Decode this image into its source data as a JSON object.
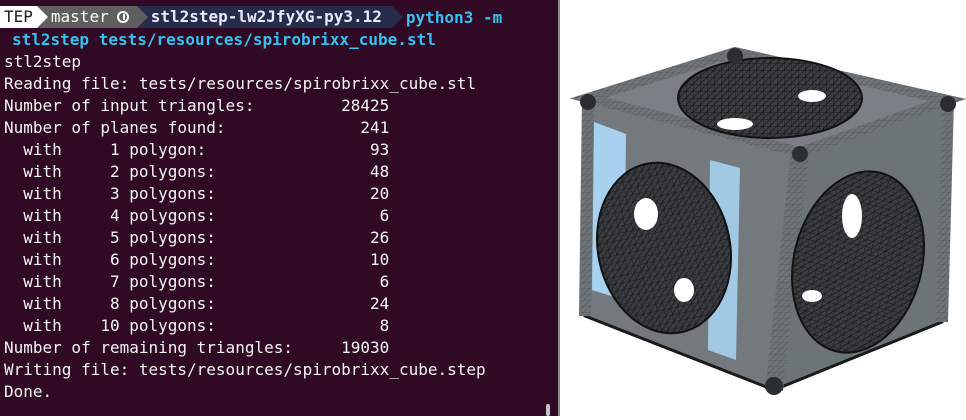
{
  "colors": {
    "terminal_bg": "#300a24",
    "command_color": "#35c2f0",
    "output_color": "#f5f5f5",
    "model_face_blue": "#a7d1ef",
    "model_face_gray": "#6d7478"
  },
  "prompt": {
    "segment_1": "TEP",
    "branch": "master",
    "branch_icon": "git-status-icon",
    "venv": "stl2step-lw2JfyXG-py3.12",
    "command_start": "python3 -m",
    "command_rest": "stl2step tests/resources/spirobrixx_cube.stl"
  },
  "output": {
    "program": "stl2step",
    "reading": "Reading file: tests/resources/spirobrixx_cube.stl",
    "input_triangles_label": "Number of input triangles:",
    "input_triangles_value": "28425",
    "planes_label": "Number of planes found:",
    "planes_value": "241",
    "polygon_rows": [
      {
        "with": "with",
        "n": "1",
        "label": "polygon:",
        "count": "93"
      },
      {
        "with": "with",
        "n": "2",
        "label": "polygons:",
        "count": "48"
      },
      {
        "with": "with",
        "n": "3",
        "label": "polygons:",
        "count": "20"
      },
      {
        "with": "with",
        "n": "4",
        "label": "polygons:",
        "count": "6"
      },
      {
        "with": "with",
        "n": "5",
        "label": "polygons:",
        "count": "26"
      },
      {
        "with": "with",
        "n": "6",
        "label": "polygons:",
        "count": "10"
      },
      {
        "with": "with",
        "n": "7",
        "label": "polygons:",
        "count": "6"
      },
      {
        "with": "with",
        "n": "8",
        "label": "polygons:",
        "count": "24"
      },
      {
        "with": "with",
        "n": "10",
        "label": "polygons:",
        "count": "8"
      }
    ],
    "remaining_label": "Number of remaining triangles:",
    "remaining_value": "19030",
    "writing": "Writing file: tests/resources/spirobrixx_cube.step",
    "done": "Done."
  },
  "viewer": {
    "model_icon": "spirobrixx-cube-3d-model"
  }
}
